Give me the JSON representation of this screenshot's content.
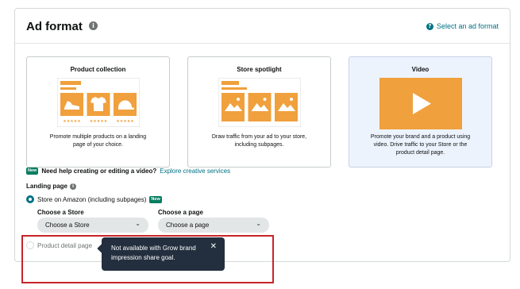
{
  "panel": {
    "title": "Ad format",
    "help_link": "Select an ad format"
  },
  "cards": [
    {
      "title": "Product collection",
      "desc_lines": [
        "Promote multiple products on a landing",
        "page of your choice."
      ]
    },
    {
      "title": "Store spotlight",
      "desc_lines": [
        "Draw traffic from your ad to your store,",
        "including subpages."
      ]
    },
    {
      "title": "Video",
      "desc_lines": [
        "Promote your brand and a product using",
        "video. Drive traffic to your Store or the",
        "product detail page."
      ]
    }
  ],
  "video_help": {
    "badge": "New",
    "question": "Need help creating or editing a video?",
    "link": "Explore creative services"
  },
  "landing_page": {
    "label": "Landing page",
    "option_store": "Store on Amazon (including subpages)",
    "option_store_badge": "New",
    "choose_store_label": "Choose a Store",
    "choose_store_value": "Choose a Store",
    "choose_page_label": "Choose a page",
    "choose_page_value": "Choose a page",
    "option_detail": "Product detail page"
  },
  "tooltip": {
    "lines": [
      "Not available with Grow brand",
      "impression share goal."
    ]
  },
  "colors": {
    "orange": "#f0a03c",
    "link": "#007185",
    "new_badge": "#067d62",
    "tooltip_bg": "#232f3e",
    "highlight": "#c8242a",
    "selected_card": "#edf3fd"
  },
  "icons": [
    "info-icon",
    "help-icon",
    "chevron-down-icon",
    "close-icon",
    "play-icon",
    "shoe-icon",
    "shirt-icon",
    "cap-icon",
    "mountain-image-icon",
    "star-icon"
  ]
}
